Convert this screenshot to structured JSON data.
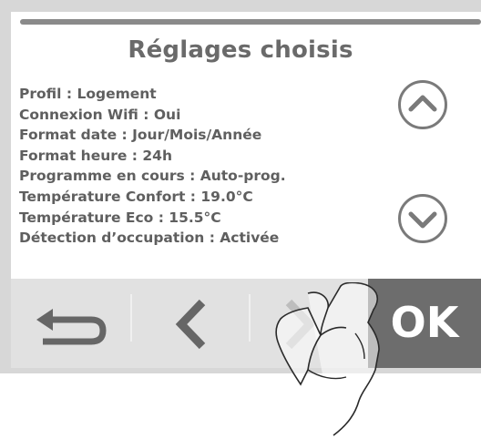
{
  "screen": {
    "title": "Réglages choisis",
    "settings": [
      "Profil : Logement",
      "Connexion Wifi : Oui",
      "Format date : Jour/Mois/Année",
      "Format heure : 24h",
      "Programme en cours : Auto-prog.",
      "Température Confort : 19.0°C",
      "Température Eco : 15.5°C",
      "Détection d’occupation : Activée"
    ]
  },
  "icons": {
    "scroll_up": "chevron-up-icon",
    "scroll_down": "chevron-down-icon",
    "back": "return-arrow-icon",
    "previous": "chevron-left-icon",
    "next": "chevron-right-icon",
    "hand": "pointing-hand-icon"
  },
  "nav": {
    "ok_label": "OK"
  },
  "colors": {
    "frame": "#d7d7d7",
    "text": "#5f5f5f",
    "ok_background": "#6d6d6d"
  }
}
